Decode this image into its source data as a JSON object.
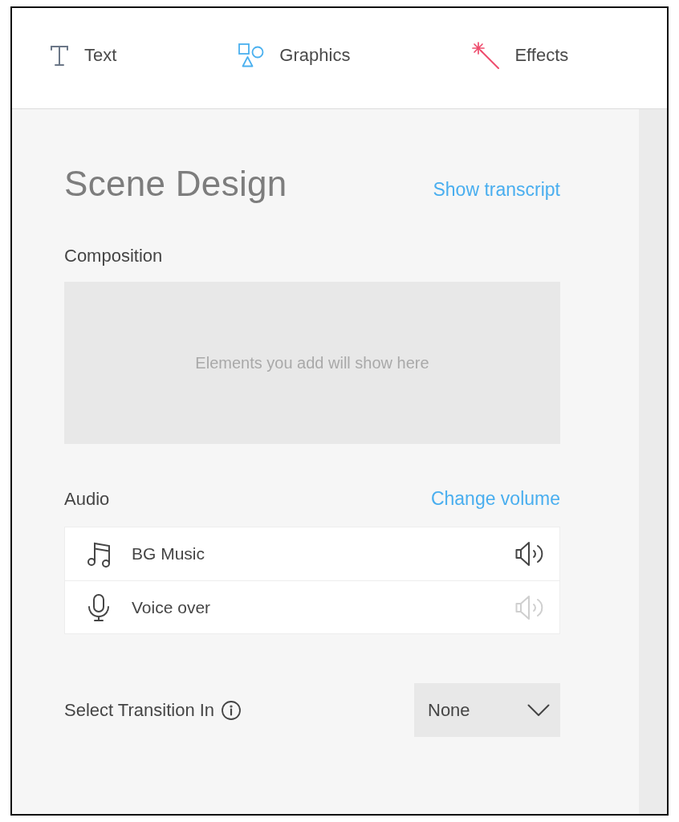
{
  "tabs": [
    {
      "kind": "text",
      "label": "Text"
    },
    {
      "kind": "graphics",
      "label": "Graphics"
    },
    {
      "kind": "effects",
      "label": "Effects"
    }
  ],
  "title": "Scene Design",
  "transcript_link": "Show transcript",
  "composition": {
    "label": "Composition",
    "hint": "Elements you add will show here"
  },
  "audio": {
    "label": "Audio",
    "action": "Change volume",
    "tracks": [
      {
        "kind": "music",
        "name": "BG Music",
        "disabled": false
      },
      {
        "kind": "voice",
        "name": "Voice over",
        "disabled": true
      }
    ]
  },
  "transition": {
    "label": "Select Transition In",
    "value": "None"
  }
}
